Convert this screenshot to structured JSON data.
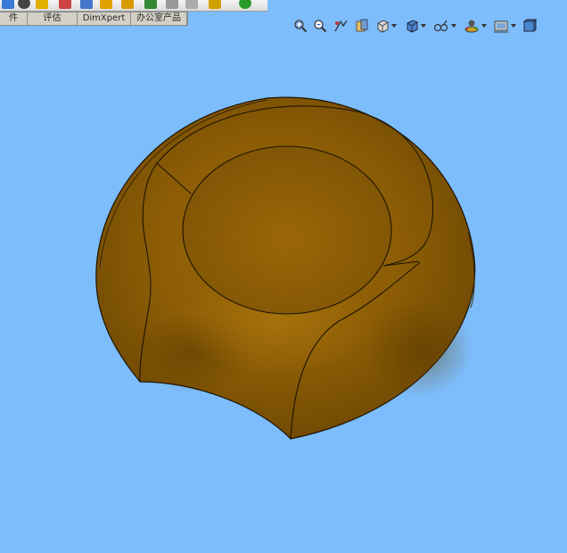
{
  "command_manager": {
    "tabs": [
      {
        "label": "件"
      },
      {
        "label": "评估"
      },
      {
        "label": "DimXpert"
      },
      {
        "label": "办公室产品"
      }
    ]
  },
  "view_toolbar": {
    "buttons": [
      {
        "icon": "zoom-to-fit-icon"
      },
      {
        "icon": "zoom-to-area-icon"
      },
      {
        "icon": "previous-view-icon"
      },
      {
        "icon": "section-view-icon"
      },
      {
        "icon": "view-orientation-icon"
      },
      {
        "icon": "display-style-icon"
      },
      {
        "icon": "hide-show-items-icon"
      },
      {
        "icon": "edit-appearance-icon"
      },
      {
        "icon": "apply-scene-icon"
      },
      {
        "icon": "view-settings-icon"
      }
    ]
  },
  "graphics_area": {
    "background_color": "#7dbdfb",
    "model_color": "#8a5c05",
    "edge_color": "#1e1404"
  }
}
